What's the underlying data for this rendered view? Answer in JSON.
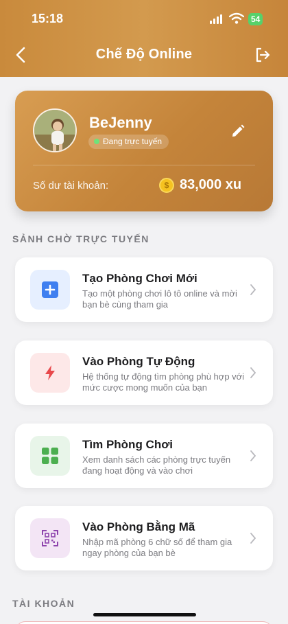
{
  "status_bar": {
    "time": "15:18",
    "battery": "54"
  },
  "header": {
    "title": "Chế Độ Online"
  },
  "profile": {
    "name": "BeJenny",
    "status": "Đang trực tuyến",
    "balance_label": "Số dư tài khoản:",
    "balance_value": "83,000 xu",
    "coin_symbol": "$"
  },
  "sections": {
    "lobby": "SẢNH CHỜ TRỰC TUYẾN",
    "account": "TÀI KHOẢN"
  },
  "cards": [
    {
      "title": "Tạo Phòng Chơi Mới",
      "desc": "Tạo một phòng chơi lô tô online và mời bạn bè cùng tham gia",
      "icon": "plus-icon",
      "icon_color": "#3f7ff0",
      "bg": "#e6efff"
    },
    {
      "title": "Vào Phòng Tự Động",
      "desc": "Hệ thống tự động tìm phòng phù hợp với mức cược mong muốn của bạn",
      "icon": "lightning-icon",
      "icon_color": "#e8484b",
      "bg": "#fde8e8"
    },
    {
      "title": "Tìm Phòng Chơi",
      "desc": "Xem danh sách các phòng trực tuyến đang hoạt động và vào chơi",
      "icon": "grid-icon",
      "icon_color": "#4caf50",
      "bg": "#e8f5e9"
    },
    {
      "title": "Vào Phòng Bằng Mã",
      "desc": "Nhập mã phòng 6 chữ số để tham gia ngay phòng của bạn bè",
      "icon": "qr-code-icon",
      "icon_color": "#8e44ad",
      "bg": "#f3e5f5"
    }
  ]
}
